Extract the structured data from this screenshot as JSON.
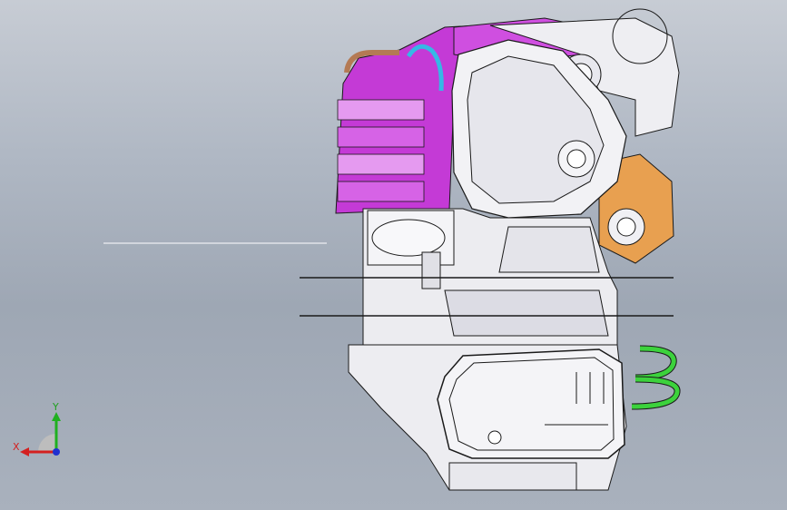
{
  "viewport": {
    "background_top": "#c7ccd4",
    "background_bottom": "#a9b1bd"
  },
  "model": {
    "description_name": "engine-assembly",
    "colors": {
      "outline": "#1a1a1a",
      "body": "#f2f2f5",
      "magenta": "#c43ad6",
      "magenta_light": "#e59af0",
      "orange": "#e8a050",
      "green": "#3cd23c",
      "cyan": "#35b8e6",
      "copper": "#b47a54"
    }
  },
  "triad": {
    "x_label": "X",
    "y_label": "Y",
    "x_color": "#d42020",
    "y_color": "#20b020",
    "z_color": "#2030d0"
  }
}
